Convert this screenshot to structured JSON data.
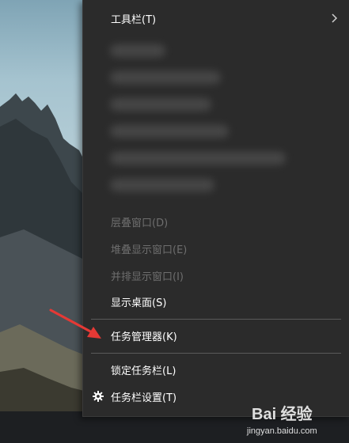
{
  "menu": {
    "toolbar_label": "工具栏(T)",
    "cascade_label": "层叠窗口(D)",
    "stacked_label": "堆叠显示窗口(E)",
    "side_by_side_label": "并排显示窗口(I)",
    "show_desktop_label": "显示桌面(S)",
    "task_manager_label": "任务管理器(K)",
    "lock_taskbar_label": "锁定任务栏(L)",
    "taskbar_settings_label": "任务栏设置(T)"
  },
  "watermark": {
    "logo_text": "Bai 经验",
    "url": "jingyan.baidu.com"
  },
  "colors": {
    "menu_bg": "#2b2b2b",
    "text": "#ffffff",
    "disabled_text": "#6e6e6e",
    "separator": "#5a5a5a",
    "arrow": "#e53935"
  },
  "icons": {
    "submenu": "chevron-right-icon",
    "settings": "gear-icon",
    "pointer": "red-arrow-icon"
  }
}
